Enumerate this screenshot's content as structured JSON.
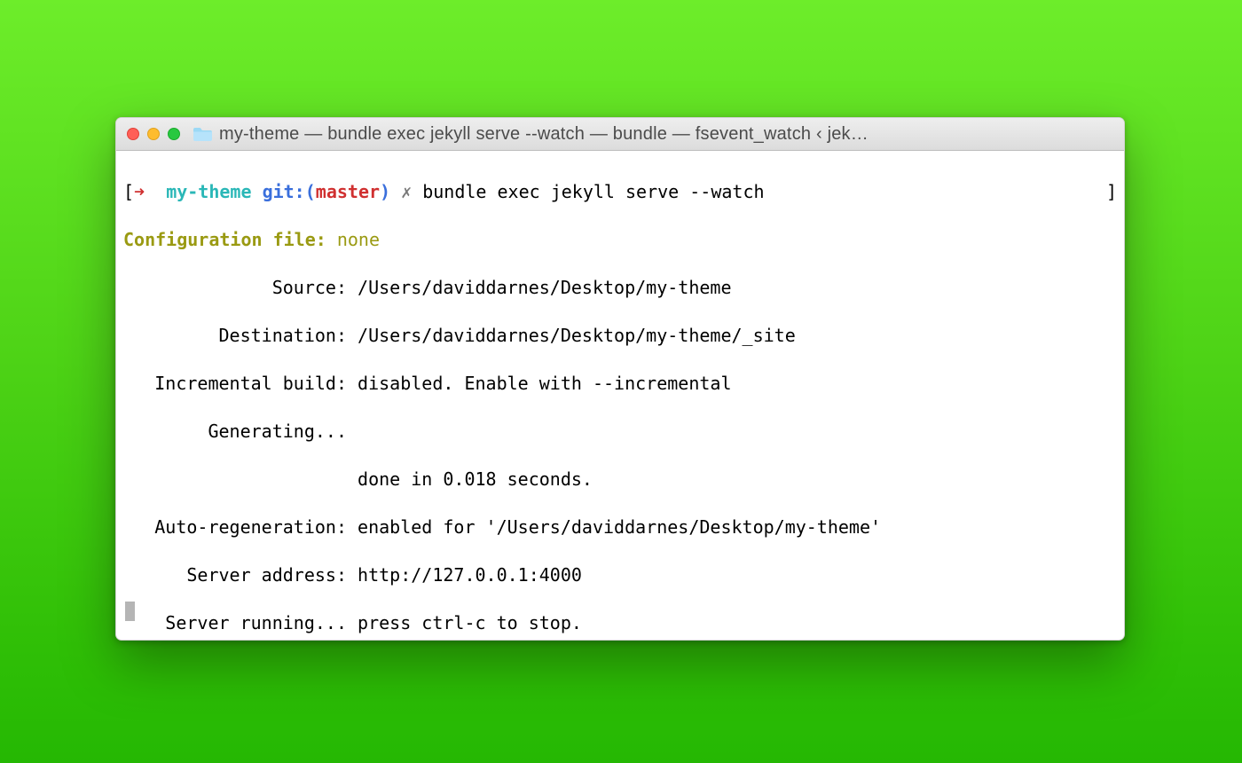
{
  "window": {
    "title": "my-theme — bundle exec jekyll serve --watch — bundle — fsevent_watch ‹ jek…"
  },
  "prompt": {
    "arrow": "➜",
    "cwd": "my-theme",
    "git_label": "git:",
    "branch": "master",
    "dirty_mark": "✗",
    "command": "bundle exec jekyll serve --watch"
  },
  "config_line": {
    "label": "Configuration file:",
    "value": "none"
  },
  "lines": [
    {
      "label": "Source:",
      "value": "/Users/daviddarnes/Desktop/my-theme"
    },
    {
      "label": "Destination:",
      "value": "/Users/daviddarnes/Desktop/my-theme/_site"
    },
    {
      "label": "Incremental build:",
      "value": "disabled. Enable with --incremental"
    },
    {
      "label": "Generating...",
      "value": ""
    },
    {
      "label": "",
      "value": "done in 0.018 seconds."
    },
    {
      "label": "Auto-regeneration:",
      "value": "enabled for '/Users/daviddarnes/Desktop/my-theme'"
    },
    {
      "label": "Server address:",
      "value": "http://127.0.0.1:4000"
    },
    {
      "label": "Server running...",
      "value": "press ctrl-c to stop."
    }
  ]
}
